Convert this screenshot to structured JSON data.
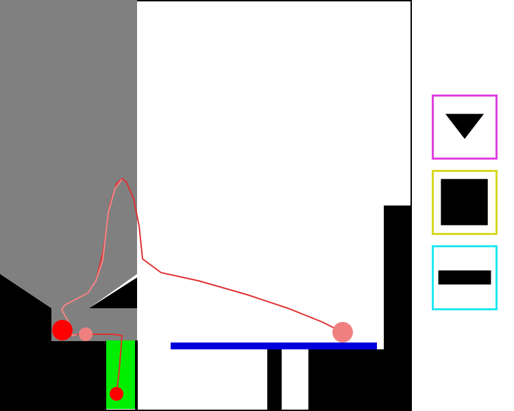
{
  "colors": {
    "background": "#ffffff",
    "wall": "#000000",
    "shaded_region": "#808080",
    "goal_zone": "#00ee00",
    "platform": "#0000dd",
    "ball_red": "#ff0000",
    "ball_pink": "#f08080",
    "trajectory_red": "#e03030",
    "trajectory_pink": "#f08888"
  },
  "toolbox": {
    "tools": [
      {
        "id": "triangle",
        "icon": "triangle-down-icon",
        "border_color": "#e040e0"
      },
      {
        "id": "square",
        "icon": "square-icon",
        "border_color": "#d8d820"
      },
      {
        "id": "bar",
        "icon": "horizontal-bar-icon",
        "border_color": "#20e8f0"
      }
    ]
  }
}
